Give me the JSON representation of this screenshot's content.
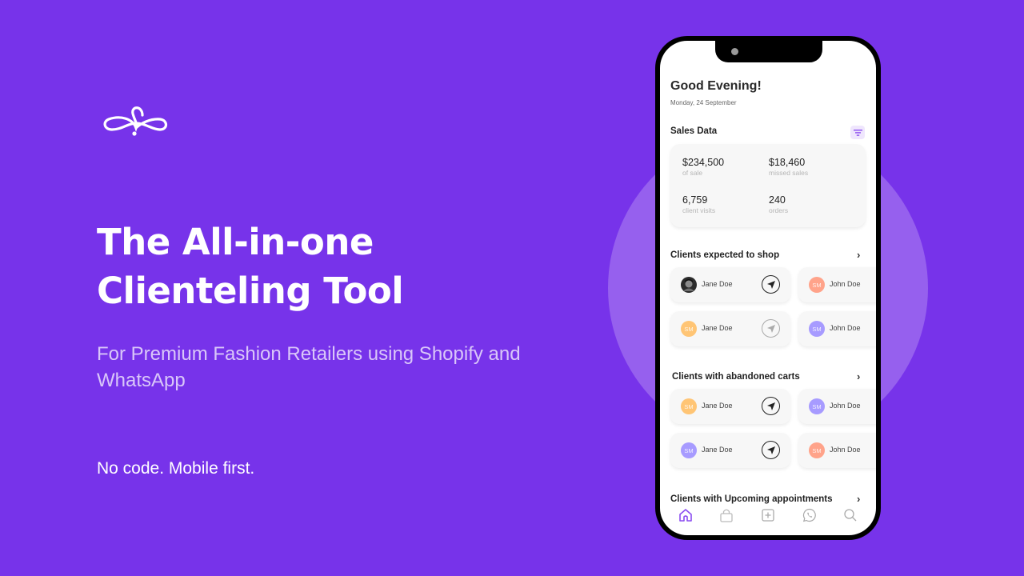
{
  "hero": {
    "logo_icon": "infinity-loop-logo-icon",
    "headline_line1": "The All-in-one",
    "headline_line2": "Clienteling Tool",
    "subtitle": "For Premium Fashion Retailers using Shopify and WhatsApp",
    "tagline": "No code. Mobile first."
  },
  "colors": {
    "background": "#7733EA",
    "circle": "#9660EE",
    "accent": "#8B4DF0"
  },
  "app": {
    "greeting": "Good Evening!",
    "date": "Monday,  24 September",
    "sales": {
      "title": "Sales Data",
      "filter_icon": "filter-icon",
      "stats": [
        {
          "value": "$234,500",
          "label": "of sale"
        },
        {
          "value": "$18,460",
          "label": "missed sales"
        },
        {
          "value": "6,759",
          "label": "client visits"
        },
        {
          "value": "240",
          "label": "orders"
        }
      ]
    },
    "sections": [
      {
        "title": "Clients expected to shop",
        "clients": [
          {
            "name": "Jane Doe",
            "initials": "",
            "avatar": "photo",
            "send_enabled": true
          },
          {
            "name": "John Doe",
            "initials": "SM",
            "avatar": "#FFA38A",
            "send_enabled": true
          },
          {
            "name": "Jane Doe",
            "initials": "SM",
            "avatar": "#FFC575",
            "send_enabled": false
          },
          {
            "name": "John Doe",
            "initials": "SM",
            "avatar": "#A79BFF",
            "send_enabled": true
          }
        ]
      },
      {
        "title": "Clients with abandoned carts",
        "clients": [
          {
            "name": "Jane Doe",
            "initials": "SM",
            "avatar": "#FFC575",
            "send_enabled": true
          },
          {
            "name": "John Doe",
            "initials": "SM",
            "avatar": "#A79BFF",
            "send_enabled": true
          },
          {
            "name": "Jane Doe",
            "initials": "SM",
            "avatar": "#A79BFF",
            "send_enabled": true
          },
          {
            "name": "John Doe",
            "initials": "SM",
            "avatar": "#FFA38A",
            "send_enabled": true
          }
        ]
      },
      {
        "title": "Clients with Upcoming appointments",
        "clients": []
      }
    ],
    "nav": [
      {
        "icon": "home-icon",
        "active": true
      },
      {
        "icon": "shopping-bag-icon",
        "active": false
      },
      {
        "icon": "add-square-icon",
        "active": false
      },
      {
        "icon": "whatsapp-icon",
        "active": false
      },
      {
        "icon": "search-icon",
        "active": false
      }
    ]
  }
}
